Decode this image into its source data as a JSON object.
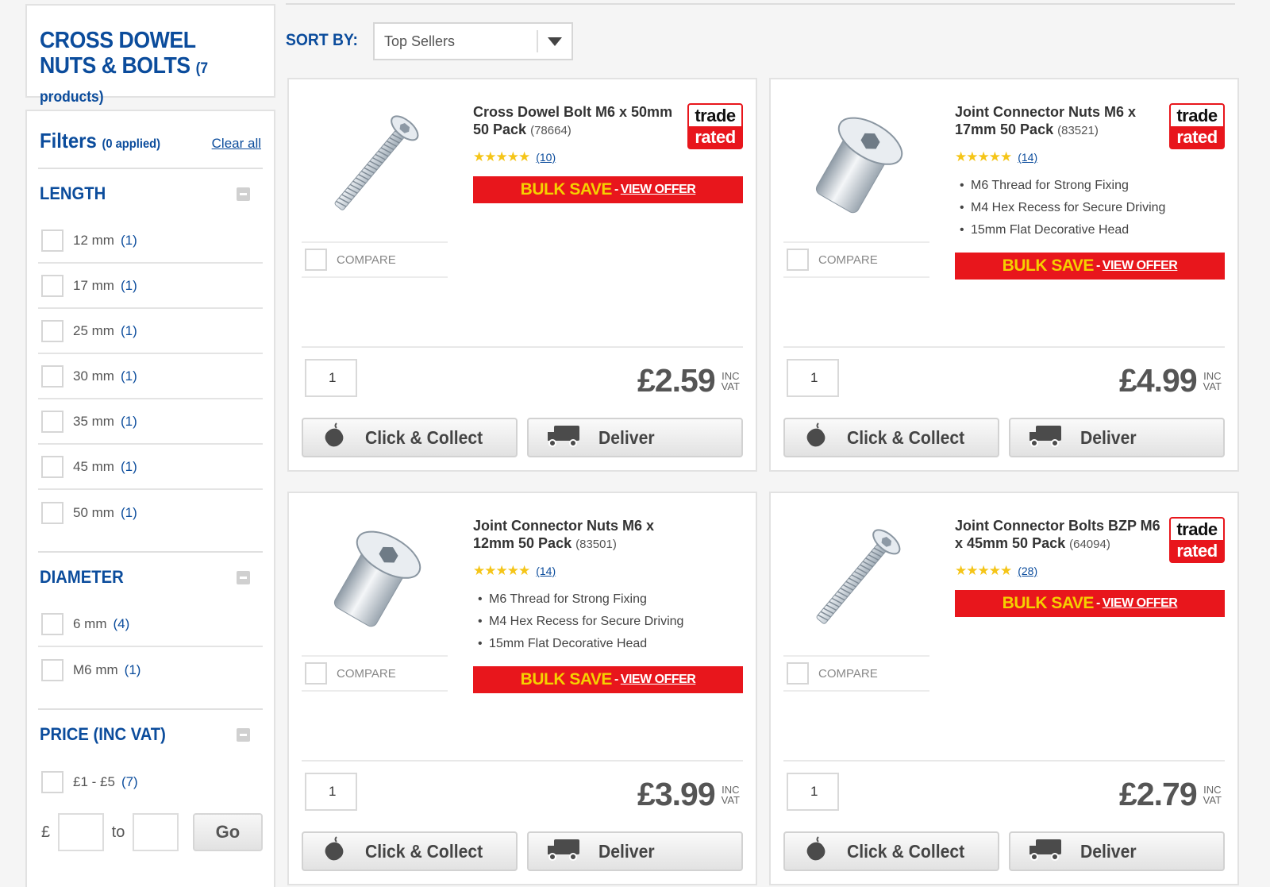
{
  "category": {
    "title": "CROSS DOWEL NUTS & BOLTS",
    "count": "(7 products)"
  },
  "filters": {
    "title": "Filters",
    "applied": "(0 applied)",
    "clear_all": "Clear all",
    "length": {
      "title": "LENGTH",
      "options": [
        {
          "label": "12 mm",
          "count": "(1)"
        },
        {
          "label": "17 mm",
          "count": "(1)"
        },
        {
          "label": "25 mm",
          "count": "(1)"
        },
        {
          "label": "30 mm",
          "count": "(1)"
        },
        {
          "label": "35 mm",
          "count": "(1)"
        },
        {
          "label": "45 mm",
          "count": "(1)"
        },
        {
          "label": "50 mm",
          "count": "(1)"
        }
      ]
    },
    "diameter": {
      "title": "DIAMETER",
      "options": [
        {
          "label": "6 mm",
          "count": "(4)"
        },
        {
          "label": "M6 mm",
          "count": "(1)"
        }
      ]
    },
    "price": {
      "title": "PRICE (INC VAT)",
      "options": [
        {
          "label": "£1 - £5",
          "count": "(7)"
        }
      ],
      "currency": "£",
      "to": "to",
      "go": "Go"
    }
  },
  "sort": {
    "label": "SORT BY:",
    "selected": "Top Sellers"
  },
  "common": {
    "compare": "COMPARE",
    "bulk_save": "BULK SAVE",
    "bulk_sep": "-",
    "view_offer": "VIEW OFFER",
    "inc": "INC",
    "vat": "VAT",
    "click_collect": "Click & Collect",
    "deliver": "Deliver",
    "trade_1": "trade",
    "trade_2": "rated"
  },
  "products": [
    {
      "name": "Cross Dowel Bolt M6 x 50mm 50 Pack",
      "code": "(78664)",
      "reviews": "(10)",
      "rating": 4.5,
      "bullets": [],
      "qty": "1",
      "price": "£2.59",
      "trade_rated": true,
      "image": "bolt-icon"
    },
    {
      "name": "Joint Connector Nuts M6 x 17mm 50 Pack",
      "code": "(83521)",
      "reviews": "(14)",
      "rating": 4.5,
      "bullets": [
        "M6 Thread for Strong Fixing",
        "M4 Hex Recess for Secure Driving",
        "15mm Flat Decorative Head"
      ],
      "qty": "1",
      "price": "£4.99",
      "trade_rated": true,
      "image": "barrel-nut-icon"
    },
    {
      "name": "Joint Connector Nuts M6 x 12mm 50 Pack",
      "code": "(83501)",
      "reviews": "(14)",
      "rating": 4.5,
      "bullets": [
        "M6 Thread for Strong Fixing",
        "M4 Hex Recess for Secure Driving",
        "15mm Flat Decorative Head"
      ],
      "qty": "1",
      "price": "£3.99",
      "trade_rated": false,
      "image": "barrel-nut-icon"
    },
    {
      "name": "Joint Connector Bolts BZP M6 x 45mm 50 Pack",
      "code": "(64094)",
      "reviews": "(28)",
      "rating": 4.5,
      "bullets": [],
      "qty": "1",
      "price": "£2.79",
      "trade_rated": true,
      "image": "bolt-icon"
    }
  ],
  "colors": {
    "brand_blue": "#0b4c9c",
    "bulk_red": "#e8161c",
    "bulk_yellow": "#f5d000",
    "star": "#f5c518"
  }
}
